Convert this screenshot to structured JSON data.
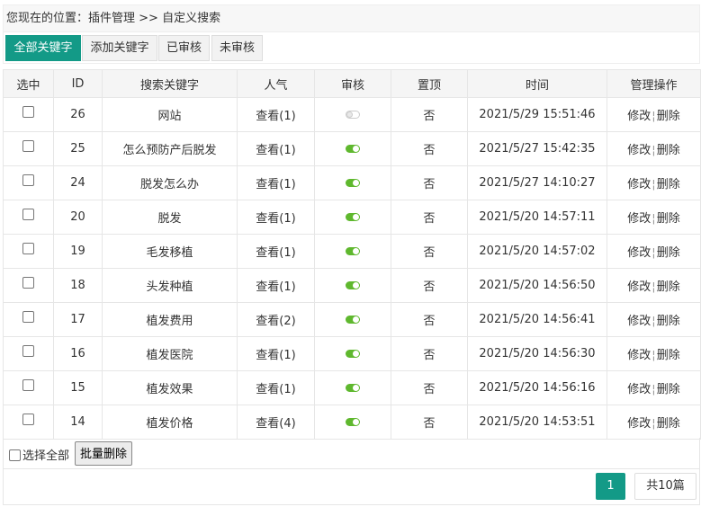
{
  "breadcrumb": {
    "prefix": "您现在的位置：",
    "parent": "插件管理",
    "separator": " >> ",
    "current": "自定义搜索"
  },
  "tabs": [
    {
      "label": "全部关键字",
      "active": true
    },
    {
      "label": "添加关键字",
      "active": false
    },
    {
      "label": "已审核",
      "active": false
    },
    {
      "label": "未审核",
      "active": false
    }
  ],
  "table": {
    "headers": {
      "select": "选中",
      "id": "ID",
      "keyword": "搜索关键字",
      "popularity": "人气",
      "review": "审核",
      "pinned": "置顶",
      "time": "时间",
      "actions": "管理操作"
    },
    "rows": [
      {
        "id": "26",
        "keyword": "网站",
        "popularity": "查看(1)",
        "approved": false,
        "pinned": "否",
        "time": "2021/5/29 15:51:46",
        "edit": "修改",
        "delete": "删除"
      },
      {
        "id": "25",
        "keyword": "怎么预防产后脱发",
        "popularity": "查看(1)",
        "approved": true,
        "pinned": "否",
        "time": "2021/5/27 15:42:35",
        "edit": "修改",
        "delete": "删除"
      },
      {
        "id": "24",
        "keyword": "脱发怎么办",
        "popularity": "查看(1)",
        "approved": true,
        "pinned": "否",
        "time": "2021/5/27 14:10:27",
        "edit": "修改",
        "delete": "删除"
      },
      {
        "id": "20",
        "keyword": "脱发",
        "popularity": "查看(1)",
        "approved": true,
        "pinned": "否",
        "time": "2021/5/20 14:57:11",
        "edit": "修改",
        "delete": "删除"
      },
      {
        "id": "19",
        "keyword": "毛发移植",
        "popularity": "查看(1)",
        "approved": true,
        "pinned": "否",
        "time": "2021/5/20 14:57:02",
        "edit": "修改",
        "delete": "删除"
      },
      {
        "id": "18",
        "keyword": "头发种植",
        "popularity": "查看(1)",
        "approved": true,
        "pinned": "否",
        "time": "2021/5/20 14:56:50",
        "edit": "修改",
        "delete": "删除"
      },
      {
        "id": "17",
        "keyword": "植发费用",
        "popularity": "查看(2)",
        "approved": true,
        "pinned": "否",
        "time": "2021/5/20 14:56:41",
        "edit": "修改",
        "delete": "删除"
      },
      {
        "id": "16",
        "keyword": "植发医院",
        "popularity": "查看(1)",
        "approved": true,
        "pinned": "否",
        "time": "2021/5/20 14:56:30",
        "edit": "修改",
        "delete": "删除"
      },
      {
        "id": "15",
        "keyword": "植发效果",
        "popularity": "查看(1)",
        "approved": true,
        "pinned": "否",
        "time": "2021/5/20 14:56:16",
        "edit": "修改",
        "delete": "删除"
      },
      {
        "id": "14",
        "keyword": "植发价格",
        "popularity": "查看(4)",
        "approved": true,
        "pinned": "否",
        "time": "2021/5/20 14:53:51",
        "edit": "修改",
        "delete": "删除"
      }
    ],
    "action_separator": "¦"
  },
  "batch": {
    "select_all": "选择全部",
    "delete_button": "批量删除"
  },
  "pagination": {
    "current_page": "1",
    "total": "共10篇"
  },
  "colors": {
    "accent": "#139a87",
    "switch_on": "#5fb82e"
  }
}
